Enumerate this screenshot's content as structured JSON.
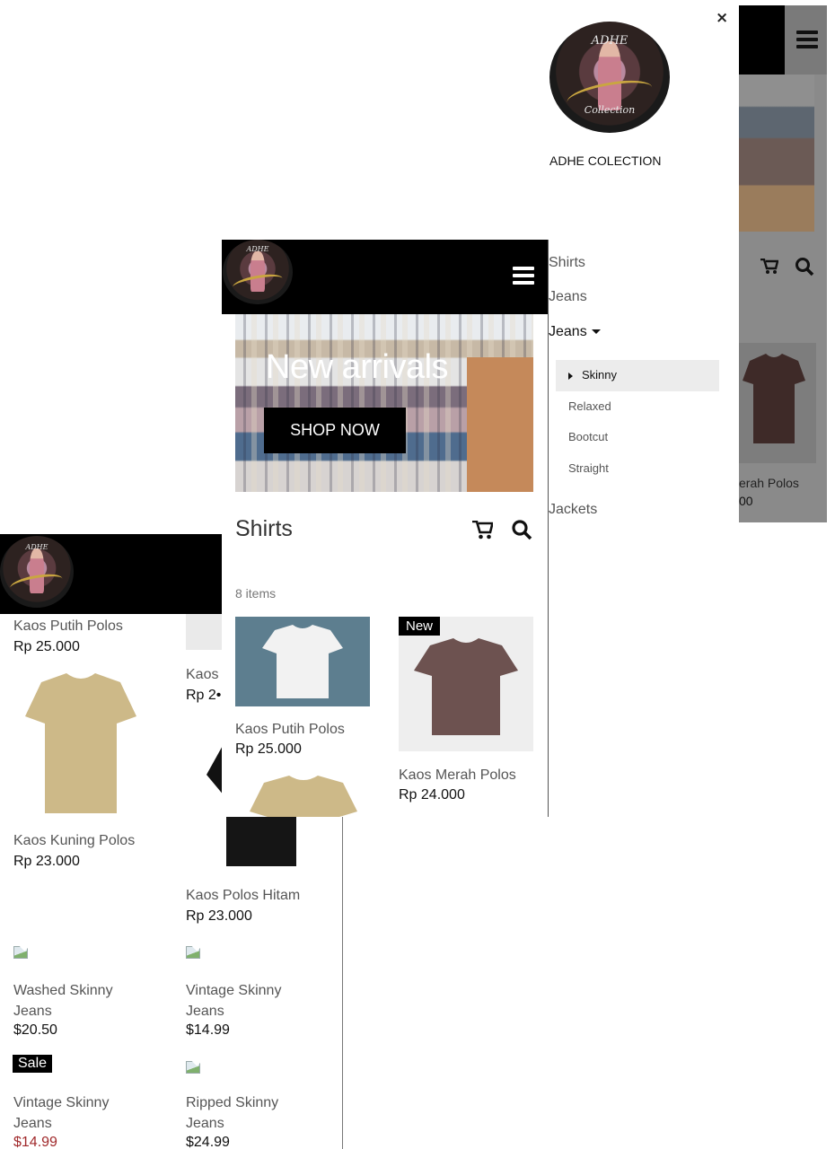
{
  "store": {
    "name": "ADHE COLECTION",
    "logo_text_top": "ADHE",
    "logo_text_bottom": "Collection"
  },
  "hero": {
    "heading": "New arrivals",
    "button_label": "SHOP NOW"
  },
  "category": {
    "title": "Shirts",
    "count_label": "8 items"
  },
  "badges": {
    "new": "New",
    "sale": "Sale"
  },
  "drawer": {
    "close_label": "×",
    "items": [
      {
        "label": "Shirts"
      },
      {
        "label": "Jeans"
      },
      {
        "label": "Jeans"
      },
      {
        "label": "Jackets"
      }
    ],
    "submenu": [
      {
        "label": "Skinny",
        "active": true
      },
      {
        "label": "Relaxed"
      },
      {
        "label": "Bootcut"
      },
      {
        "label": "Straight"
      }
    ]
  },
  "products_mid": [
    {
      "name": "Kaos Putih Polos",
      "price": "Rp 25.000",
      "color": "#f2f2f2"
    },
    {
      "name": "Kaos Merah Polos",
      "price": "Rp 24.000",
      "color": "#6d5250"
    }
  ],
  "products_back": [
    {
      "name": "Kaos Putih Polos",
      "price": "Rp 25.000"
    },
    {
      "name": "Kaos Kuning Polos",
      "price": "Rp 23.000",
      "color": "#cdb988"
    },
    {
      "name": "Kaos Polos Hitam",
      "price": "Rp 23.000",
      "color": "#151515"
    },
    {
      "name": "Washed Skinny Jeans",
      "price": "$20.50"
    },
    {
      "name": "Vintage Skinny Jeans",
      "price": "$14.99"
    },
    {
      "name": "Vintage Skinny Jeans",
      "price": "$14.99"
    },
    {
      "name": "Ripped Skinny Jeans",
      "price": "$24.99"
    }
  ],
  "partial_text": {
    "kaos": "Kaos",
    "rp_partial": "Rp 2•",
    "back_a_name": "erah Polos",
    "back_a_price": "00"
  },
  "colors": {
    "sale_price": "#a0292b",
    "bar": "#000000",
    "menu_active_bg": "#ececec"
  }
}
